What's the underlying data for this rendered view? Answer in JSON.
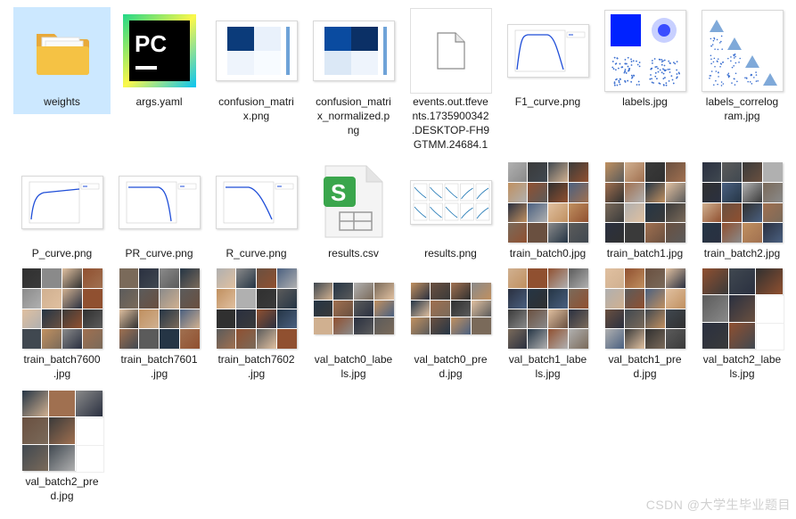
{
  "files": [
    {
      "name": "weights",
      "icon": "folder-icon",
      "selected": true
    },
    {
      "name": "args.yaml",
      "icon": "pycharm-icon"
    },
    {
      "name": "confusion_matrix.png",
      "icon": "confusion-matrix-thumbnail"
    },
    {
      "name": "confusion_matrix_normalized.png",
      "icon": "confusion-matrix-normalized-thumbnail"
    },
    {
      "name": "events.out.tfevents.1735900342.DESKTOP-FH9GTMM.24684.1",
      "icon": "blank-file-icon"
    },
    {
      "name": "F1_curve.png",
      "icon": "f1-curve-thumbnail"
    },
    {
      "name": "labels.jpg",
      "icon": "labels-thumbnail"
    },
    {
      "name": "labels_correlogram.jpg",
      "icon": "correlogram-thumbnail"
    },
    {
      "name": "P_curve.png",
      "icon": "p-curve-thumbnail"
    },
    {
      "name": "PR_curve.png",
      "icon": "pr-curve-thumbnail"
    },
    {
      "name": "R_curve.png",
      "icon": "r-curve-thumbnail"
    },
    {
      "name": "results.csv",
      "icon": "spreadsheet-file-icon"
    },
    {
      "name": "results.png",
      "icon": "results-thumbnail"
    },
    {
      "name": "train_batch0.jpg",
      "icon": "photo-grid-thumbnail"
    },
    {
      "name": "train_batch1.jpg",
      "icon": "photo-grid-thumbnail"
    },
    {
      "name": "train_batch2.jpg",
      "icon": "photo-grid-thumbnail"
    },
    {
      "name": "train_batch7600.jpg",
      "icon": "photo-grid-thumbnail"
    },
    {
      "name": "train_batch7601.jpg",
      "icon": "photo-grid-thumbnail"
    },
    {
      "name": "train_batch7602.jpg",
      "icon": "photo-grid-thumbnail"
    },
    {
      "name": "val_batch0_labels.jpg",
      "icon": "photo-grid-wide-thumbnail"
    },
    {
      "name": "val_batch0_pred.jpg",
      "icon": "photo-grid-wide-thumbnail"
    },
    {
      "name": "val_batch1_labels.jpg",
      "icon": "photo-grid-thumbnail"
    },
    {
      "name": "val_batch1_pred.jpg",
      "icon": "photo-grid-thumbnail"
    },
    {
      "name": "val_batch2_labels.jpg",
      "icon": "photo-grid-partial-thumbnail"
    },
    {
      "name": "val_batch2_pred.jpg",
      "icon": "photo-grid-partial-thumbnail"
    }
  ],
  "labels": [
    [
      "weights"
    ],
    [
      "args.yaml"
    ],
    [
      "confusion_matri",
      "x.png"
    ],
    [
      "confusion_matri",
      "x_normalized.p",
      "ng"
    ],
    [
      "events.out.tfeve",
      "nts.1735900342",
      ".DESKTOP-FH9",
      "GTMM.24684.1"
    ],
    [
      "F1_curve.png"
    ],
    [
      "labels.jpg"
    ],
    [
      "labels_correlog",
      "ram.jpg"
    ],
    [
      "P_curve.png"
    ],
    [
      "PR_curve.png"
    ],
    [
      "R_curve.png"
    ],
    [
      "results.csv"
    ],
    [
      "results.png"
    ],
    [
      "train_batch0.jpg"
    ],
    [
      "train_batch1.jpg"
    ],
    [
      "train_batch2.jpg"
    ],
    [
      "train_batch7600",
      ".jpg"
    ],
    [
      "train_batch7601",
      ".jpg"
    ],
    [
      "train_batch7602",
      ".jpg"
    ],
    [
      "val_batch0_labe",
      "ls.jpg"
    ],
    [
      "val_batch0_pre",
      "d.jpg"
    ],
    [
      "val_batch1_labe",
      "ls.jpg"
    ],
    [
      "val_batch1_pre",
      "d.jpg"
    ],
    [
      "val_batch2_labe",
      "ls.jpg"
    ],
    [
      "val_batch2_pre",
      "d.jpg"
    ]
  ],
  "watermark": "CSDN @大学生毕业题目",
  "colors": {
    "selection": "#cce8ff",
    "folder": "#f5c244",
    "pycharm_green": "#21d789",
    "csv_green": "#3aa64c",
    "plot_blue": "#1f4ed8"
  }
}
